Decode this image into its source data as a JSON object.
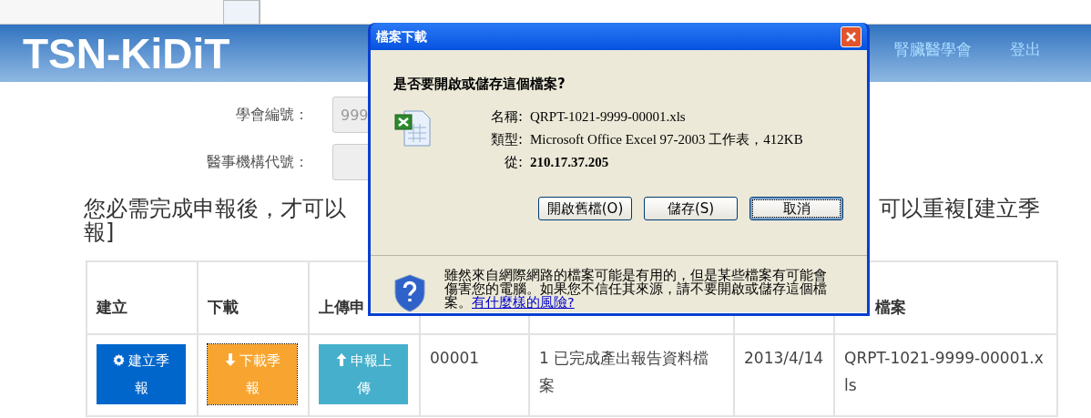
{
  "header": {
    "logo": "TSN-KiDiT",
    "nav": [
      {
        "label": "腎臟醫學會"
      },
      {
        "label": "登出"
      }
    ]
  },
  "form": {
    "fields": [
      {
        "label": "學會編號：",
        "value": "999"
      },
      {
        "label": "醫事機構代號："
      }
    ]
  },
  "notice": {
    "line1_start": "您必需完成申報後，才可以",
    "line1_end": "可以重複[建立季",
    "line2": "報]"
  },
  "table": {
    "columns": [
      {
        "label": "建立"
      },
      {
        "label": "下載"
      },
      {
        "label": "上傳申"
      },
      {},
      {},
      {},
      {
        "label": "檔案"
      }
    ],
    "rows": [
      {
        "cells": [
          {
            "kind": "create",
            "label": "建立季報",
            "color": "#0066cc",
            "focused": false
          },
          {
            "kind": "download",
            "label": "下載季報",
            "color": "#f7a530",
            "focused": true
          },
          {
            "kind": "upload",
            "label": "申報上傳",
            "color": "#46b0cc",
            "focused": false
          },
          {
            "kind": "text",
            "text": "00001"
          },
          {
            "kind": "text",
            "text": "1 已完成產出報告資料檔案"
          },
          {
            "kind": "text",
            "text": "2013/4/14"
          },
          {
            "kind": "text",
            "text": "QRPT-1021-9999-00001.xls"
          }
        ]
      }
    ]
  },
  "dialog": {
    "title": "檔案下載",
    "question": "是否要開啟或儲存這個檔案?",
    "details": [
      {
        "label": "名稱:",
        "value": "QRPT-1021-9999-00001.xls",
        "bold": false
      },
      {
        "label": "類型:",
        "value": "Microsoft Office Excel 97-2003 工作表，412KB",
        "bold": false
      },
      {
        "label": "從:",
        "value": "210.17.37.205",
        "bold": true
      }
    ],
    "buttons": [
      {
        "label": "開啟舊檔(O)",
        "default": false
      },
      {
        "label": "儲存(S)",
        "default": false
      },
      {
        "label": "取消",
        "default": true
      }
    ],
    "warning": {
      "text": "雖然來自網際網路的檔案可能是有用的，但是某些檔案有可能會傷害您的電腦。如果您不信任其來源，請不要開啟或儲存這個檔案。",
      "link": "有什麼樣的風險?"
    }
  }
}
